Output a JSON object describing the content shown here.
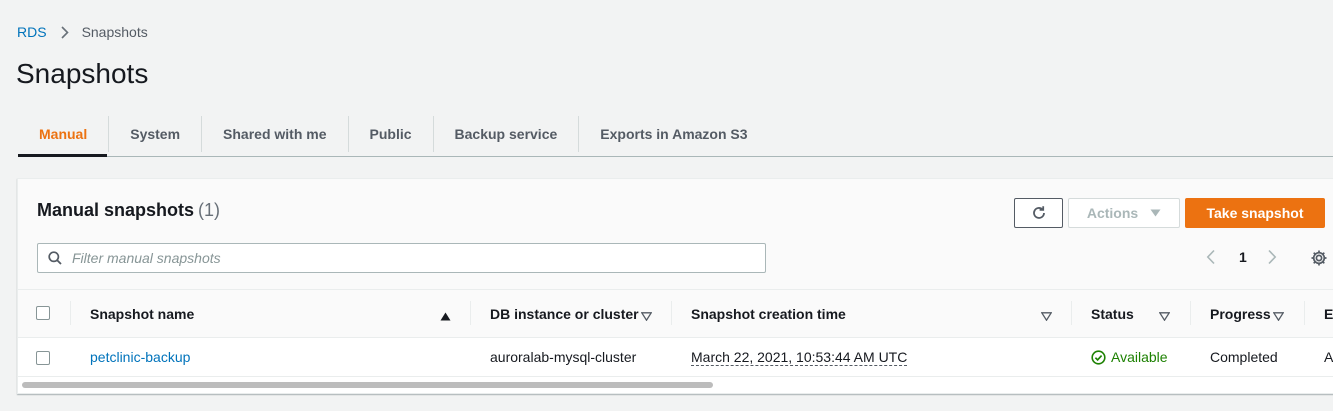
{
  "breadcrumb": {
    "root": "RDS",
    "current": "Snapshots"
  },
  "page": {
    "title": "Snapshots"
  },
  "tabs": [
    {
      "label": "Manual",
      "active": true
    },
    {
      "label": "System"
    },
    {
      "label": "Shared with me"
    },
    {
      "label": "Public"
    },
    {
      "label": "Backup service"
    },
    {
      "label": "Exports in Amazon S3"
    }
  ],
  "panel": {
    "title": "Manual snapshots",
    "count": "(1)",
    "actions_label": "Actions",
    "take_label": "Take snapshot",
    "search_placeholder": "Filter manual snapshots",
    "page_number": "1"
  },
  "table": {
    "columns": {
      "name": "Snapshot name",
      "instance": "DB instance or cluster",
      "created": "Snapshot creation time",
      "status": "Status",
      "progress": "Progress",
      "next": "E"
    },
    "rows": [
      {
        "name": "petclinic-backup",
        "instance": "auroralab-mysql-cluster",
        "created": "March 22, 2021, 10:53:44 AM UTC",
        "status": "Available",
        "progress": "Completed",
        "next": "A"
      }
    ]
  },
  "colors": {
    "accent": "#ec7211",
    "link": "#0073bb",
    "success": "#1d8102",
    "text": "#16191f"
  },
  "icons": [
    "chevron-right-icon",
    "refresh-icon",
    "caret-down-icon",
    "search-icon",
    "chevron-left-icon",
    "gear-icon",
    "sort-up-icon",
    "sort-down-icon",
    "status-ok-icon"
  ]
}
